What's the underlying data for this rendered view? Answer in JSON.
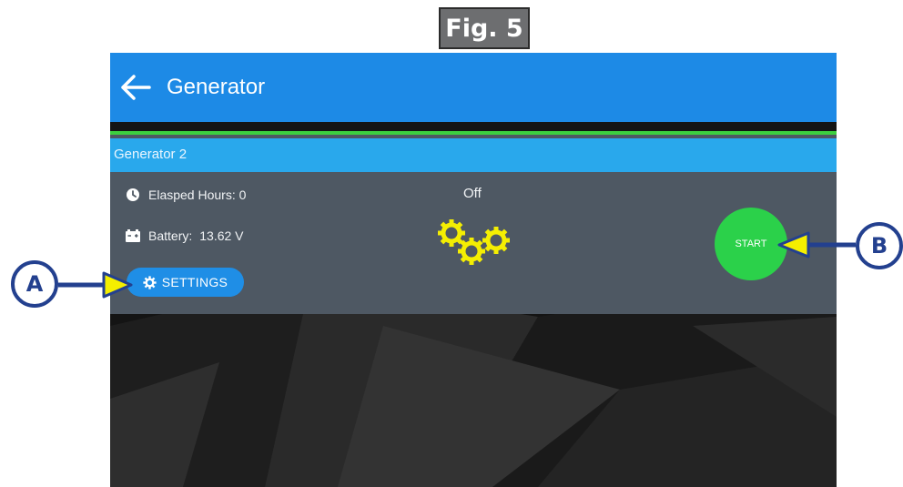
{
  "figure": {
    "label": "Fig. 5"
  },
  "appbar": {
    "title": "Generator",
    "back_icon": "arrow-left-icon",
    "color": "#1d8ae6"
  },
  "generator_card": {
    "title": "Generator 2",
    "accent_color": "#3ccf3f",
    "header_color": "#29a8ec",
    "elapsed_hours": {
      "icon": "clock-icon",
      "label": "Elasped Hours: 0"
    },
    "battery": {
      "icon": "battery-icon",
      "label": "Battery:",
      "value": "13.62 V"
    },
    "status": "Off",
    "status_icon": "gears-icon",
    "start_button": {
      "label": "START",
      "color": "#2bd14a"
    },
    "settings_button": {
      "icon": "gear-icon",
      "label": "SETTINGS",
      "color": "#1f8ee6"
    }
  },
  "callouts": [
    {
      "label": "A",
      "target": "settings_button"
    },
    {
      "label": "B",
      "target": "start_button"
    }
  ],
  "colors": {
    "callout_blue": "#23408f",
    "arrow_yellow": "#f5ef00",
    "gear_yellow": "#f4ee02"
  }
}
